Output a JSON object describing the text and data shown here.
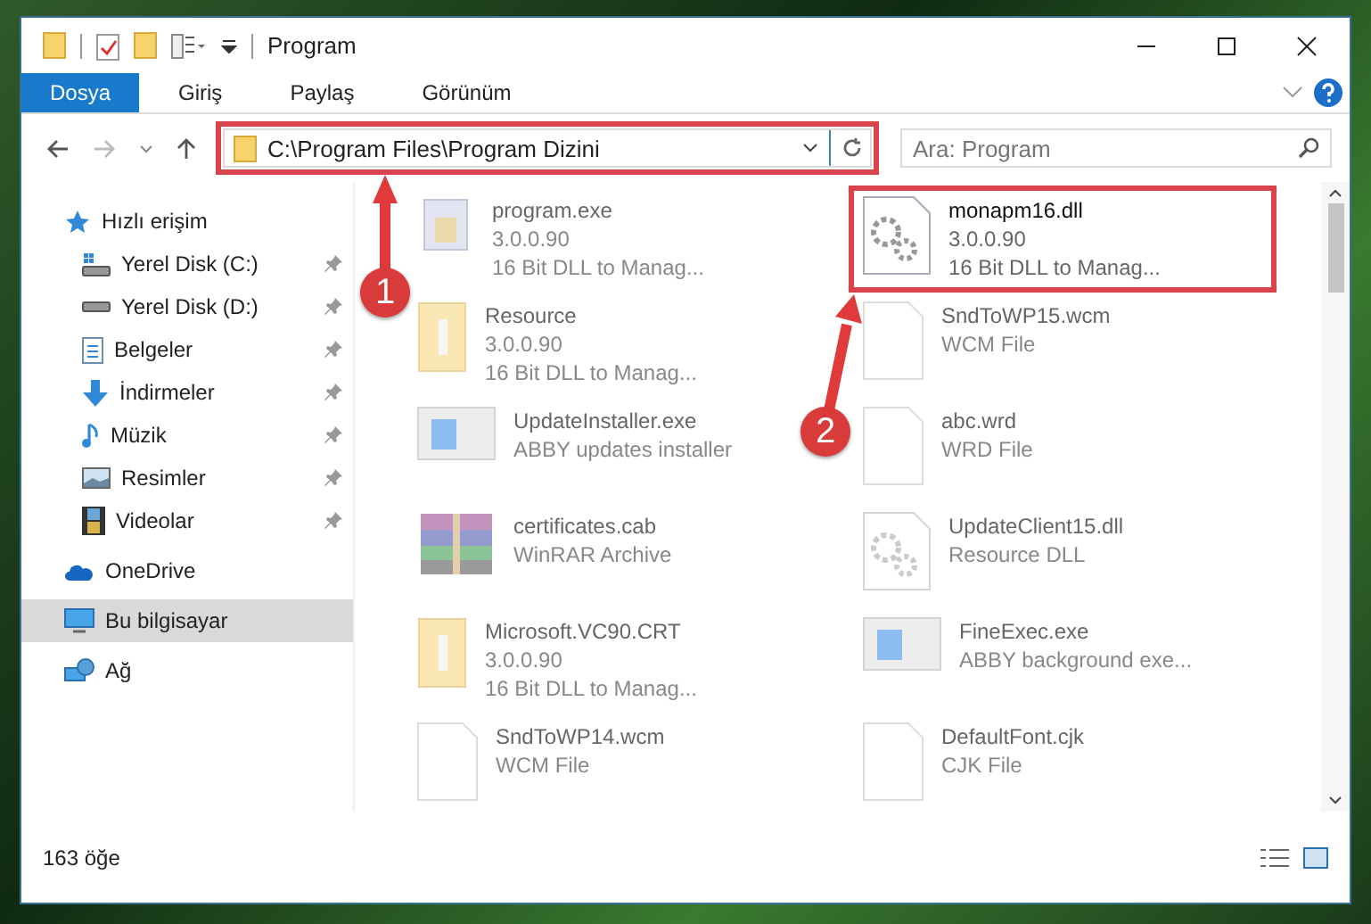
{
  "window": {
    "title": "Program"
  },
  "ribbon": {
    "tabs": [
      {
        "label": "Dosya",
        "selected": true
      },
      {
        "label": "Giriş",
        "selected": false
      },
      {
        "label": "Paylaş",
        "selected": false
      },
      {
        "label": "Görünüm",
        "selected": false
      }
    ]
  },
  "address_bar": {
    "path": "C:\\Program Files\\Program Dizini",
    "highlighted": true
  },
  "search": {
    "placeholder": "Ara: Program"
  },
  "sidebar": {
    "items": [
      {
        "label": "Hızlı erişim",
        "selected": false,
        "children": [
          {
            "label": "Yerel Disk (C:)",
            "pinned": true,
            "selected": false
          },
          {
            "label": "Yerel Disk (D:)",
            "pinned": true,
            "selected": false
          },
          {
            "label": "Belgeler",
            "pinned": true,
            "selected": false
          },
          {
            "label": "İndirmeler",
            "pinned": true,
            "selected": false
          },
          {
            "label": "Müzik",
            "pinned": true,
            "selected": false
          },
          {
            "label": "Resimler",
            "pinned": true,
            "selected": false
          },
          {
            "label": "Videolar",
            "pinned": true,
            "selected": false
          }
        ]
      },
      {
        "label": "OneDrive",
        "selected": false
      },
      {
        "label": "Bu bilgisayar",
        "selected": true
      },
      {
        "label": "Ağ",
        "selected": false
      }
    ]
  },
  "files": [
    {
      "name": "program.exe",
      "lines": [
        "3.0.0.90",
        "16 Bit DLL to Manag..."
      ],
      "kind": "exe",
      "highlighted": false
    },
    {
      "name": "monapm16.dll",
      "lines": [
        "3.0.0.90",
        "16 Bit DLL to Manag..."
      ],
      "kind": "dll",
      "highlighted": true
    },
    {
      "name": "Resource",
      "lines": [
        "3.0.0.90",
        "16 Bit DLL to Manag..."
      ],
      "kind": "folder",
      "highlighted": false
    },
    {
      "name": "SndToWP15.wcm",
      "lines": [
        "WCM File"
      ],
      "kind": "file",
      "highlighted": false
    },
    {
      "name": "UpdateInstaller.exe",
      "lines": [
        "ABBY updates installer"
      ],
      "kind": "app",
      "highlighted": false
    },
    {
      "name": "abc.wrd",
      "lines": [
        "WRD File"
      ],
      "kind": "file",
      "highlighted": false
    },
    {
      "name": "certificates.cab",
      "lines": [
        "WinRAR Archive"
      ],
      "kind": "archive",
      "highlighted": false
    },
    {
      "name": "UpdateClient15.dll",
      "lines": [
        "Resource DLL"
      ],
      "kind": "dll",
      "highlighted": false
    },
    {
      "name": "Microsoft.VC90.CRT",
      "lines": [
        "3.0.0.90",
        "16 Bit DLL to Manag..."
      ],
      "kind": "folder",
      "highlighted": false
    },
    {
      "name": "FineExec.exe",
      "lines": [
        "ABBY background exe..."
      ],
      "kind": "app",
      "highlighted": false
    },
    {
      "name": "SndToWP14.wcm",
      "lines": [
        "WCM File"
      ],
      "kind": "file",
      "highlighted": false
    },
    {
      "name": "DefaultFont.cjk",
      "lines": [
        "CJK File"
      ],
      "kind": "file",
      "highlighted": false
    }
  ],
  "callouts": [
    {
      "number": "1"
    },
    {
      "number": "2"
    }
  ],
  "status_bar": {
    "count": "163 öğe"
  }
}
